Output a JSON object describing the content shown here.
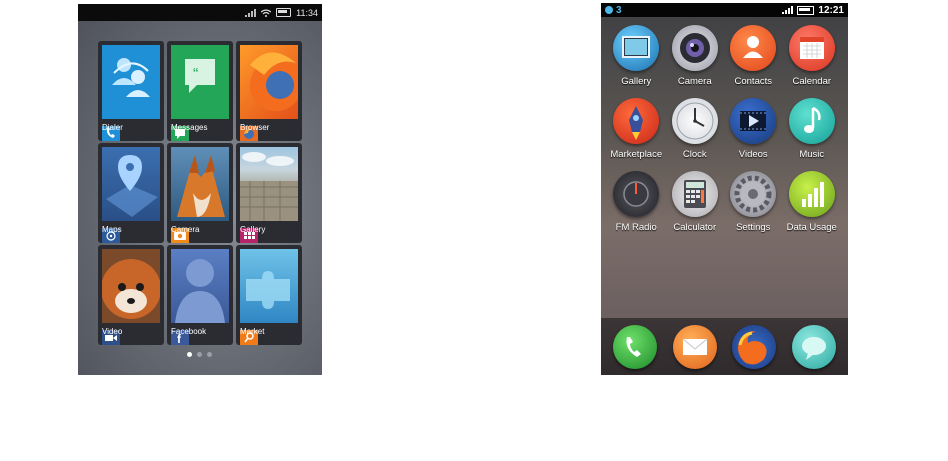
{
  "left_phone": {
    "status": {
      "time": "11:34"
    },
    "tiles": [
      {
        "label": "Dialer"
      },
      {
        "label": "Messages"
      },
      {
        "label": "Browser"
      },
      {
        "label": "Maps"
      },
      {
        "label": "Camera"
      },
      {
        "label": "Gallery"
      },
      {
        "label": "Video"
      },
      {
        "label": "Facebook"
      },
      {
        "label": "Market"
      }
    ],
    "pager": {
      "pages": 3,
      "current": 1
    }
  },
  "right_phone": {
    "status": {
      "notification_count": "3",
      "time": "12:21"
    },
    "apps": [
      {
        "label": "Gallery"
      },
      {
        "label": "Camera"
      },
      {
        "label": "Contacts"
      },
      {
        "label": "Calendar"
      },
      {
        "label": "Marketplace"
      },
      {
        "label": "Clock"
      },
      {
        "label": "Videos"
      },
      {
        "label": "Music"
      },
      {
        "label": "FM Radio"
      },
      {
        "label": "Calculator"
      },
      {
        "label": "Settings"
      },
      {
        "label": "Data Usage"
      }
    ],
    "dock_icons": [
      "phone-icon",
      "email-icon",
      "firefox-icon",
      "messages-icon"
    ]
  }
}
